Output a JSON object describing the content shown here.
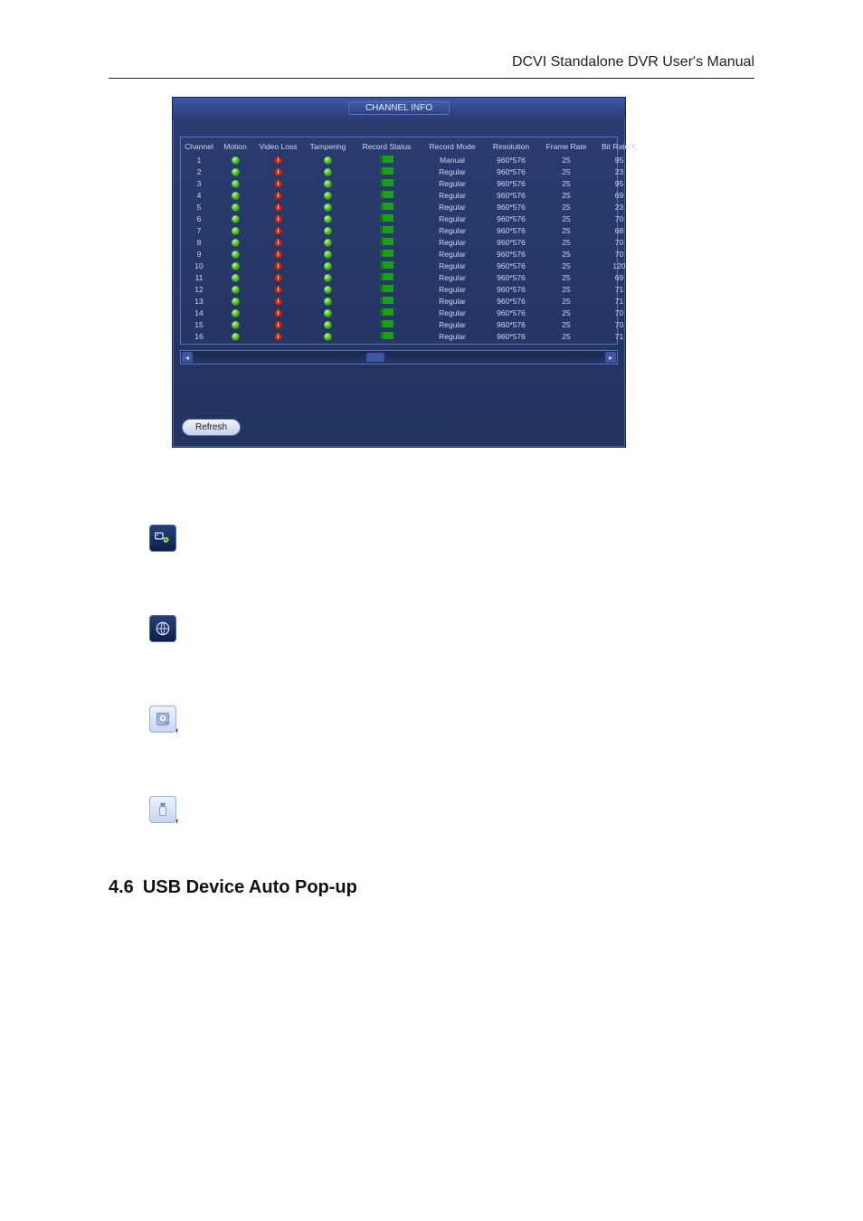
{
  "header": {
    "title": "DCVI Standalone DVR User's Manual"
  },
  "dvr": {
    "title": "CHANNEL INFO",
    "columns": [
      "Channel",
      "Motion",
      "Video Loss",
      "Tampering",
      "Record Status",
      "Record Mode",
      "Resolution",
      "Frame Rate",
      "Bit Rate(K"
    ],
    "rows": [
      {
        "ch": "1",
        "mode": "Manual",
        "res": "960*576",
        "fr": "25",
        "br": "95"
      },
      {
        "ch": "2",
        "mode": "Regular",
        "res": "960*576",
        "fr": "25",
        "br": "23"
      },
      {
        "ch": "3",
        "mode": "Regular",
        "res": "960*576",
        "fr": "25",
        "br": "95"
      },
      {
        "ch": "4",
        "mode": "Regular",
        "res": "960*576",
        "fr": "25",
        "br": "69"
      },
      {
        "ch": "5",
        "mode": "Regular",
        "res": "960*576",
        "fr": "25",
        "br": "23"
      },
      {
        "ch": "6",
        "mode": "Regular",
        "res": "960*576",
        "fr": "25",
        "br": "70"
      },
      {
        "ch": "7",
        "mode": "Regular",
        "res": "960*576",
        "fr": "25",
        "br": "68"
      },
      {
        "ch": "8",
        "mode": "Regular",
        "res": "960*576",
        "fr": "25",
        "br": "70"
      },
      {
        "ch": "9",
        "mode": "Regular",
        "res": "960*576",
        "fr": "25",
        "br": "70"
      },
      {
        "ch": "10",
        "mode": "Regular",
        "res": "960*576",
        "fr": "25",
        "br": "120"
      },
      {
        "ch": "11",
        "mode": "Regular",
        "res": "960*576",
        "fr": "25",
        "br": "69"
      },
      {
        "ch": "12",
        "mode": "Regular",
        "res": "960*576",
        "fr": "25",
        "br": "71"
      },
      {
        "ch": "13",
        "mode": "Regular",
        "res": "960*576",
        "fr": "25",
        "br": "71"
      },
      {
        "ch": "14",
        "mode": "Regular",
        "res": "960*576",
        "fr": "25",
        "br": "70"
      },
      {
        "ch": "15",
        "mode": "Regular",
        "res": "960*576",
        "fr": "25",
        "br": "70"
      },
      {
        "ch": "16",
        "mode": "Regular",
        "res": "960*576",
        "fr": "25",
        "br": "71"
      }
    ],
    "refresh": "Refresh"
  },
  "icons": {
    "remote": "remote-device-icon",
    "network": "network-icon",
    "hdd": "hdd-icon",
    "usb": "usb-icon"
  },
  "punct": {
    "comma": ","
  },
  "section": {
    "num": "4.6",
    "title": "USB Device Auto Pop-up"
  }
}
